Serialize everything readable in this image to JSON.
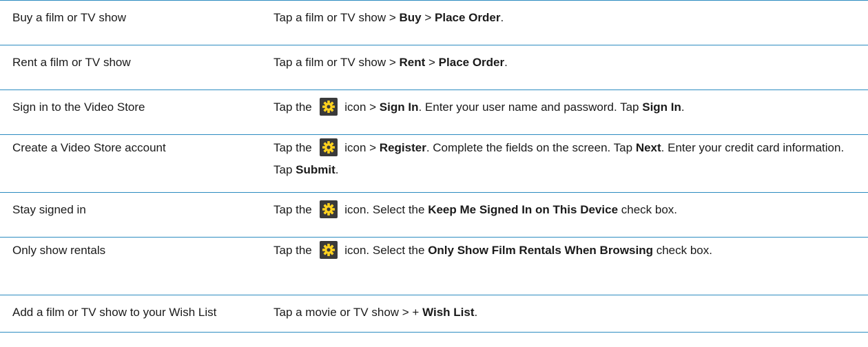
{
  "table": {
    "rows": [
      {
        "task": "Buy a film or TV show",
        "steps": [
          {
            "t": "Tap a film or TV show > "
          },
          {
            "t": "Buy",
            "b": true
          },
          {
            "t": " > "
          },
          {
            "t": "Place Order",
            "b": true
          },
          {
            "t": "."
          }
        ]
      },
      {
        "task": "Rent a film or TV show",
        "steps": [
          {
            "t": "Tap a film or TV show > "
          },
          {
            "t": "Rent",
            "b": true
          },
          {
            "t": " > "
          },
          {
            "t": "Place Order",
            "b": true
          },
          {
            "t": "."
          }
        ]
      },
      {
        "task": "Sign in to the Video Store",
        "steps": [
          {
            "t": "Tap the "
          },
          {
            "icon": "gear-icon"
          },
          {
            "t": " icon > "
          },
          {
            "t": "Sign In",
            "b": true
          },
          {
            "t": ". Enter your user name and password. Tap "
          },
          {
            "t": "Sign In",
            "b": true
          },
          {
            "t": "."
          }
        ]
      },
      {
        "task": "Create a Video Store account",
        "steps": [
          {
            "t": "Tap the "
          },
          {
            "icon": "gear-icon"
          },
          {
            "t": " icon > "
          },
          {
            "t": "Register",
            "b": true
          },
          {
            "t": ". Complete the fields on the screen. Tap "
          },
          {
            "t": "Next",
            "b": true
          },
          {
            "t": ". Enter your credit card information. Tap "
          },
          {
            "t": "Submit",
            "b": true
          },
          {
            "t": "."
          }
        ]
      },
      {
        "task": "Stay signed in",
        "steps": [
          {
            "t": "Tap the "
          },
          {
            "icon": "gear-icon"
          },
          {
            "t": " icon. Select the "
          },
          {
            "t": "Keep Me Signed In on This Device",
            "b": true
          },
          {
            "t": " check box."
          }
        ]
      },
      {
        "task": "Only show rentals",
        "steps": [
          {
            "t": "Tap the "
          },
          {
            "icon": "gear-icon"
          },
          {
            "t": " icon. Select the "
          },
          {
            "t": "Only Show Film Rentals When Browsing",
            "b": true
          },
          {
            "t": " check box."
          }
        ]
      },
      {
        "task": "Add a film or TV show to your Wish List",
        "steps": [
          {
            "t": "Tap a movie or TV show > + "
          },
          {
            "t": "Wish List",
            "b": true
          },
          {
            "t": "."
          }
        ]
      }
    ]
  }
}
